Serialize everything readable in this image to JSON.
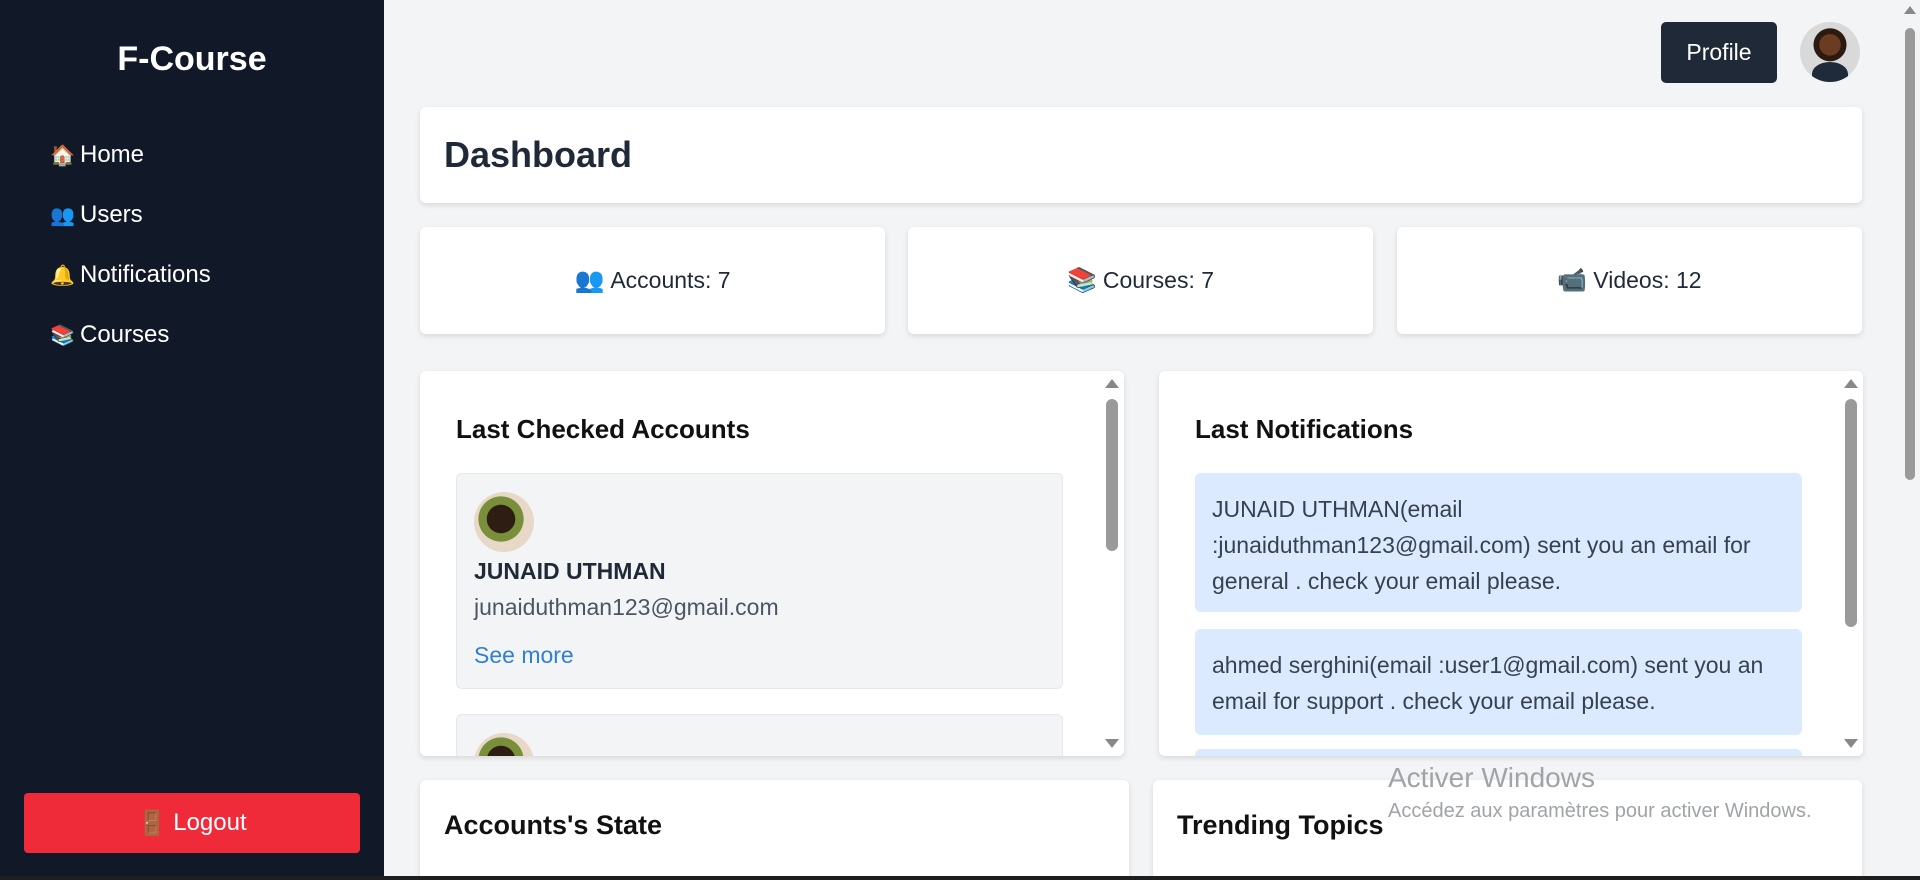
{
  "brand": "F-Course",
  "nav": [
    {
      "icon": "🏠",
      "icon_name": "home-icon",
      "label": "Home"
    },
    {
      "icon": "👥",
      "icon_name": "users-icon",
      "label": "Users"
    },
    {
      "icon": "🔔",
      "icon_name": "bell-icon",
      "label": "Notifications"
    },
    {
      "icon": "📚",
      "icon_name": "books-icon",
      "label": "Courses"
    }
  ],
  "logout": {
    "icon": "🚪",
    "label": "Logout"
  },
  "header": {
    "profile_label": "Profile"
  },
  "dashboard_title": "Dashboard",
  "stats": [
    {
      "icon": "👥",
      "icon_name": "accounts-icon",
      "label": "Accounts: 7"
    },
    {
      "icon": "📚",
      "icon_name": "courses-icon",
      "label": "Courses: 7"
    },
    {
      "icon": "📹",
      "icon_name": "videos-icon",
      "label": "Videos: 12"
    }
  ],
  "last_accounts": {
    "title": "Last Checked Accounts",
    "items": [
      {
        "name": "JUNAID UTHMAN",
        "email": "junaiduthman123@gmail.com",
        "link": "See more"
      }
    ]
  },
  "last_notifications": {
    "title": "Last Notifications",
    "items": [
      {
        "text": "JUNAID UTHMAN(email :junaiduthman123@gmail.com) sent you an email for general . check your email please."
      },
      {
        "text": "ahmed serghini(email :user1@gmail.com) sent you an email for support . check your email please."
      }
    ]
  },
  "bottom": {
    "accounts_state_title": "Accounts's State",
    "trending_title": "Trending Topics"
  },
  "watermark": {
    "line1": "Activer Windows",
    "line2": "Accédez aux paramètres pour activer Windows."
  },
  "colors": {
    "sidebar": "#111827",
    "logout": "#ef2b3a",
    "link": "#2f7fd3",
    "notification_bg": "#dbeafe"
  }
}
